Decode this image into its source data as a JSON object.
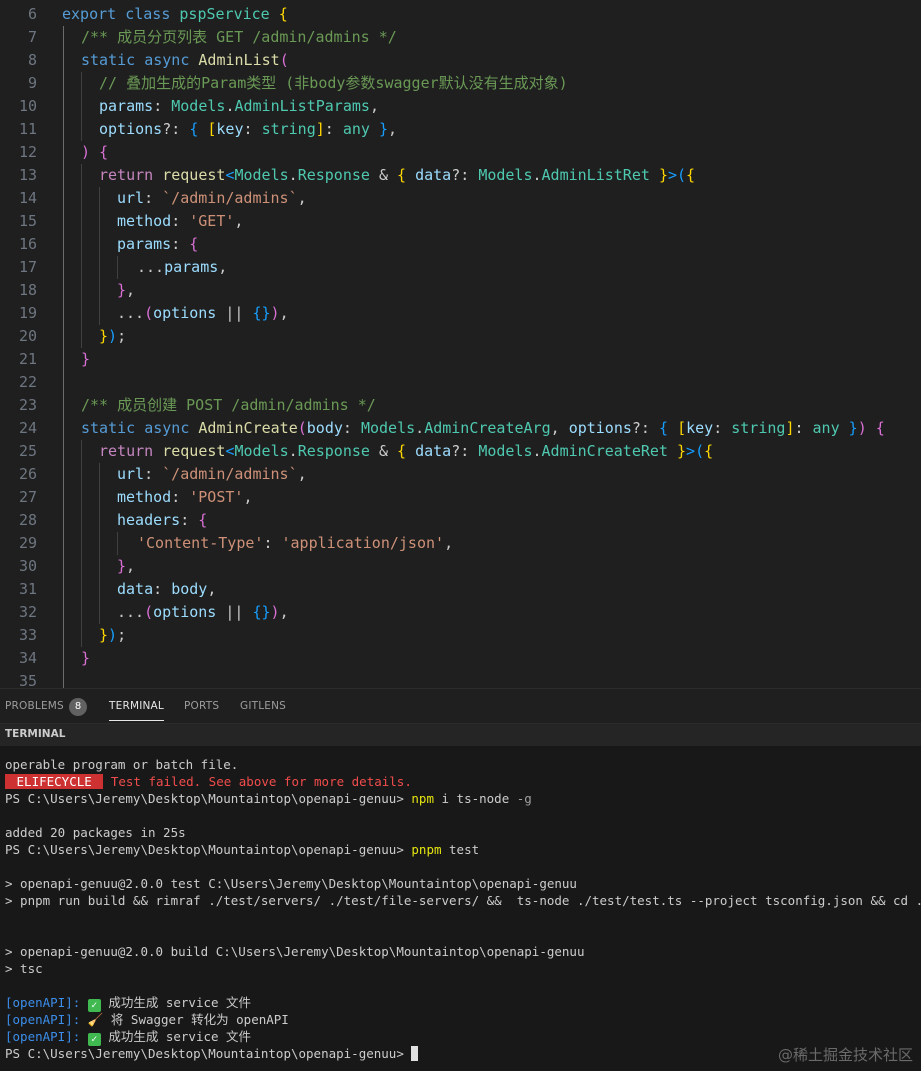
{
  "editor": {
    "line_numbers": [
      "6",
      "7",
      "8",
      "9",
      "10",
      "11",
      "12",
      "13",
      "14",
      "15",
      "16",
      "17",
      "18",
      "19",
      "20",
      "21",
      "22",
      "23",
      "24",
      "25",
      "26",
      "27",
      "28",
      "29",
      "30",
      "31",
      "32",
      "33",
      "34",
      "35"
    ]
  },
  "panel": {
    "tabs": [
      "PROBLEMS",
      "TERMINAL",
      "PORTS",
      "GITLENS"
    ],
    "problems_count": "8"
  },
  "terminal": {
    "header": "TERMINAL",
    "lines": {
      "l1": "operable program or batch file.",
      "err_badge": " ELIFECYCLE ",
      "err_msg": " Test failed. See above for more details.",
      "prompt": "PS C:\\Users\\Jeremy\\Desktop\\Mountaintop\\openapi-genuu> ",
      "cmd1_a": "npm",
      "cmd1_b": " i ts-node ",
      "cmd1_c": "-g",
      "added": "added 20 packages in 25s",
      "cmd2_a": "pnpm",
      "cmd2_b": " test",
      "test_hdr": "> openapi-genuu@2.0.0 test C:\\Users\\Jeremy\\Desktop\\Mountaintop\\openapi-genuu",
      "test_cmd": "> pnpm run build && rimraf ./test/servers/ ./test/file-servers/ &&  ts-node ./test/test.ts --project tsconfig.json && cd ..",
      "build_hdr": "> openapi-genuu@2.0.0 build C:\\Users\\Jeremy\\Desktop\\Mountaintop\\openapi-genuu",
      "build_cmd": "> tsc",
      "tag": "[openAPI]:",
      "msg1": " 成功生成 service 文件",
      "msg2": " 将 Swagger 转化为 openAPI",
      "msg3": " 成功生成 service 文件"
    }
  },
  "watermark": "@稀土掘金技术社区"
}
